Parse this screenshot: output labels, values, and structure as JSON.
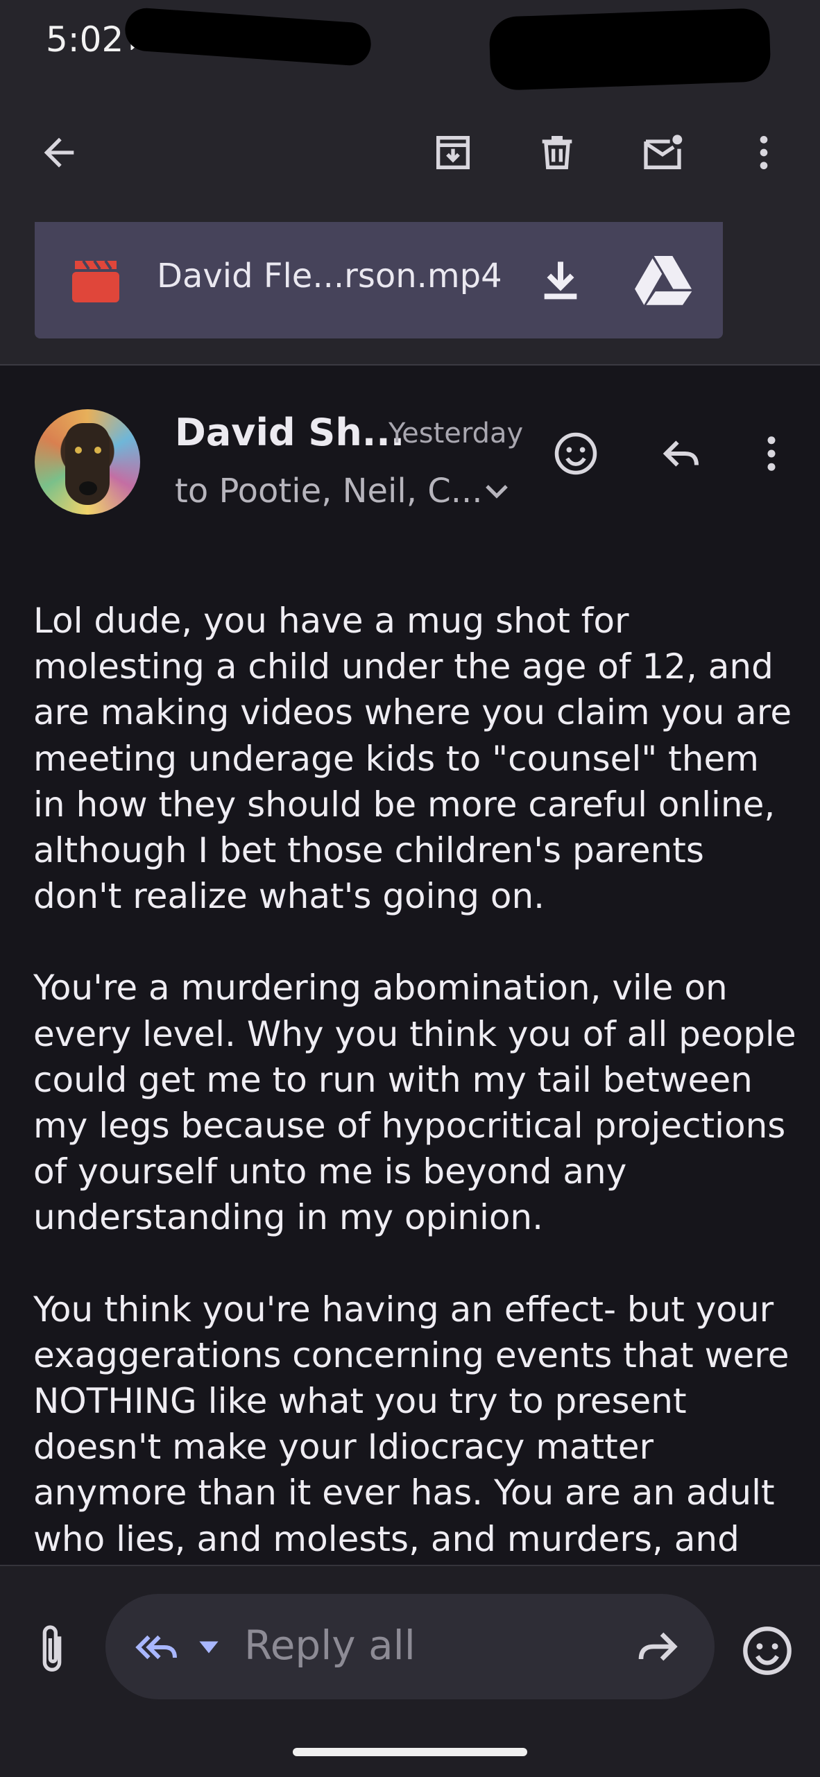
{
  "status_bar": {
    "time": "5:02"
  },
  "toolbar": {
    "back_icon": "arrow-back-icon",
    "archive_icon": "archive-icon",
    "delete_icon": "trash-icon",
    "mark_unread_icon": "mail-unread-icon",
    "more_icon": "more-vert-icon"
  },
  "attachment": {
    "icon": "video-clapper-icon",
    "filename": "David Fle...rson.mp4",
    "download_icon": "download-icon",
    "drive_icon": "google-drive-icon",
    "video_icon_color": "#e0463a"
  },
  "message": {
    "sender": "David Sh...",
    "time": "Yesterday",
    "recipients": "to Pootie, Neil, C...",
    "react_icon": "emoji-smile-icon",
    "reply_icon": "reply-icon",
    "more_icon": "more-vert-icon",
    "body": [
      "Lol dude, you have a mug shot for molesting a child under the age of 12, and are making videos where you claim you are meeting underage kids to \"counsel\" them in how they should be more careful online, although I bet those children's parents don't realize what's going on.",
      "You're a murdering abomination, vile on every level. Why you think you of all people could get me to run with my tail between my legs because of hypocritical projections of yourself unto me is beyond any understanding in my opinion.",
      "You think you're having an effect- but your exaggerations concerning events that were NOTHING like what you try to present doesn't make your Idiocracy matter anymore than it ever has. You are an adult who lies, and molests, and murders, and"
    ]
  },
  "compose_bar": {
    "attach_icon": "paperclip-icon",
    "reply_all_icon": "reply-all-icon",
    "reply_label": "Reply all",
    "forward_icon": "forward-icon",
    "emoji_icon": "emoji-smile-icon"
  },
  "colors": {
    "background": "#16151b",
    "toolbar": "#26252b",
    "attachment_chip": "#46435a",
    "reply_pill": "#2e2d36",
    "accent_reply_icon": "#a9b7ff"
  }
}
